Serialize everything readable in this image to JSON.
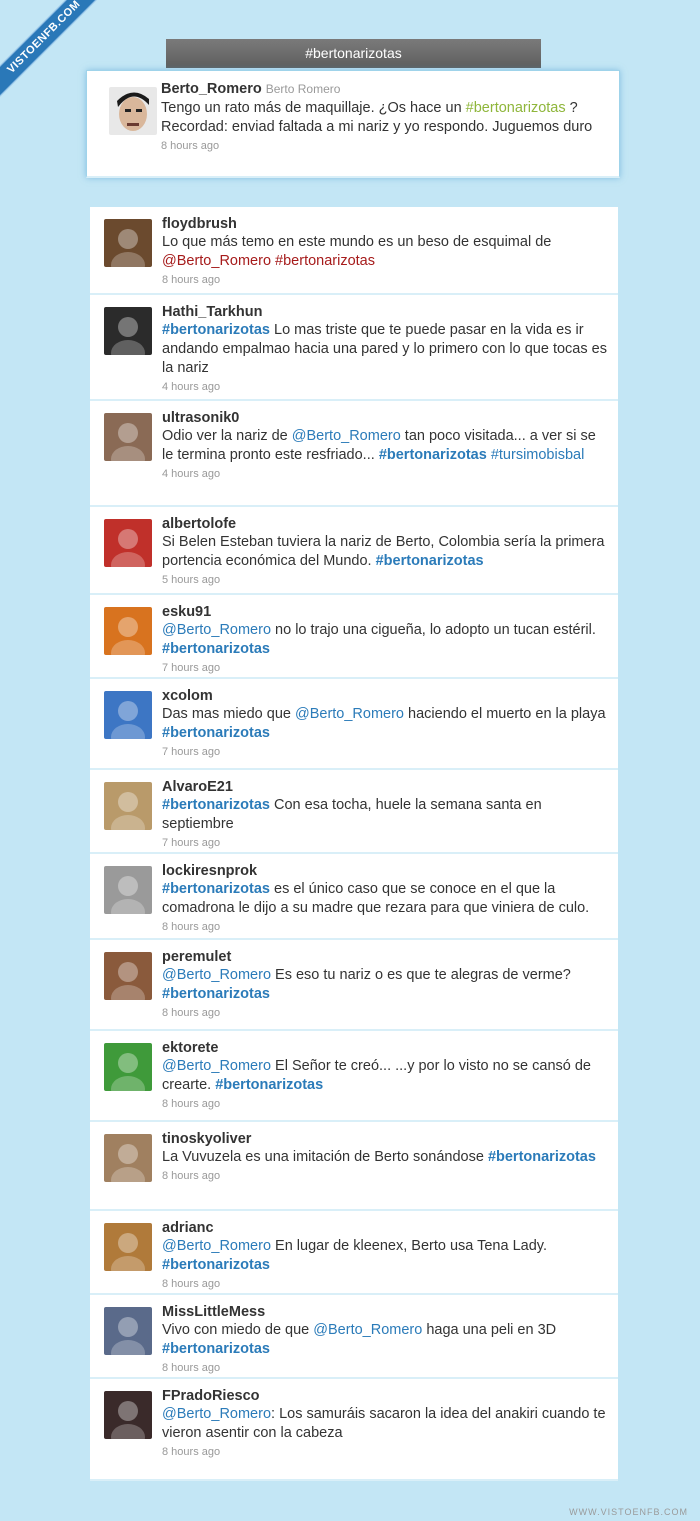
{
  "watermark": "VISTOENFB.COM",
  "footer": "WWW.VISTOENFB.COM",
  "title": "#bertonarizotas",
  "featured": {
    "username": "Berto_Romero",
    "realname": "Berto Romero",
    "text_before": "Tengo un rato más de maquillaje. ¿Os hace un ",
    "hashtag": "#bertonarizotas",
    "text_after": " ? Recordad: enviad faltada a mi nariz y yo respondo. Juguemos duro",
    "time": "8 hours ago",
    "avatar_color": "#d0d0d0"
  },
  "tweets": [
    {
      "username": "floydbrush",
      "segments": [
        {
          "t": "Lo que más temo en este mundo es un beso de esquimal de "
        },
        {
          "t": "@Berto_Romero",
          "k": "mention"
        },
        {
          "t": " "
        },
        {
          "t": "#bertonarizotas",
          "k": "hashtag"
        }
      ],
      "time": "8 hours ago",
      "avatar_color": "#6b4a2e"
    },
    {
      "username": "Hathi_Tarkhun",
      "segments": [
        {
          "t": "#bertonarizotas",
          "k": "hashtag"
        },
        {
          "t": " Lo mas triste que te puede pasar en la vida es ir andando empalmao hacia una pared y lo primero con lo que tocas es la nariz"
        }
      ],
      "time": "4 hours ago",
      "avatar_color": "#2b2b2b"
    },
    {
      "username": "ultrasonik0",
      "segments": [
        {
          "t": "Odio ver la nariz de "
        },
        {
          "t": "@Berto_Romero",
          "k": "mention"
        },
        {
          "t": " tan poco visitada... a ver si se le termina pronto este resfriado... "
        },
        {
          "t": "#bertonarizotas",
          "k": "hashtag"
        },
        {
          "t": " "
        },
        {
          "t": "#tursimobisbal",
          "k": "mention"
        }
      ],
      "time": "4 hours ago",
      "avatar_color": "#8a6a55"
    },
    {
      "username": "albertolofe",
      "segments": [
        {
          "t": "Si Belen Esteban tuviera la nariz de Berto, Colombia sería la primera portencia económica del Mundo. "
        },
        {
          "t": "#bertonarizotas",
          "k": "hashtag"
        }
      ],
      "time": "5 hours ago",
      "avatar_color": "#c0302a"
    },
    {
      "username": "esku91",
      "segments": [
        {
          "t": "@Berto_Romero",
          "k": "mention"
        },
        {
          "t": " no lo trajo una cigueña, lo adopto un tucan estéril. "
        },
        {
          "t": "#bertonarizotas",
          "k": "hashtag"
        }
      ],
      "time": "7 hours ago",
      "avatar_color": "#d8731f"
    },
    {
      "username": "xcolom",
      "segments": [
        {
          "t": "Das mas miedo que "
        },
        {
          "t": "@Berto_Romero",
          "k": "mention"
        },
        {
          "t": " haciendo el muerto en la playa "
        },
        {
          "t": "#bertonarizotas",
          "k": "hashtag"
        }
      ],
      "time": "7 hours ago",
      "avatar_color": "#3d76c4"
    },
    {
      "username": "AlvaroE21",
      "segments": [
        {
          "t": "#bertonarizotas",
          "k": "hashtag"
        },
        {
          "t": " Con esa tocha, huele la semana santa en septiembre"
        }
      ],
      "time": "7 hours ago",
      "avatar_color": "#b99a6a"
    },
    {
      "username": "lockiresnprok",
      "segments": [
        {
          "t": "#bertonarizotas",
          "k": "hashtag"
        },
        {
          "t": " es el único caso que se conoce en el que la comadrona le dijo a su madre que rezara para que viniera de culo."
        }
      ],
      "time": "8 hours ago",
      "avatar_color": "#9a9a9a"
    },
    {
      "username": "peremulet",
      "segments": [
        {
          "t": "@Berto_Romero",
          "k": "mention"
        },
        {
          "t": " Es eso tu nariz o es que te alegras de verme? "
        },
        {
          "t": "#bertonarizotas",
          "k": "hashtag"
        }
      ],
      "time": "8 hours ago",
      "avatar_color": "#8a5a3c"
    },
    {
      "username": "ektorete",
      "segments": [
        {
          "t": "@Berto_Romero",
          "k": "mention"
        },
        {
          "t": " El Señor te creó... ...y por lo visto no se cansó de crearte. "
        },
        {
          "t": "#bertonarizotas",
          "k": "hashtag"
        }
      ],
      "time": "8 hours ago",
      "avatar_color": "#3f9a3a"
    },
    {
      "username": "tinoskyoliver",
      "segments": [
        {
          "t": "La Vuvuzela es una imitación de Berto sonándose "
        },
        {
          "t": "#bertonarizotas",
          "k": "hashtag"
        }
      ],
      "time": "8 hours ago",
      "avatar_color": "#a08060"
    },
    {
      "username": "adrianc",
      "segments": [
        {
          "t": "@Berto_Romero",
          "k": "mention"
        },
        {
          "t": " En lugar de kleenex, Berto usa Tena Lady. "
        },
        {
          "t": "#bertonarizotas",
          "k": "hashtag"
        }
      ],
      "time": "8 hours ago",
      "avatar_color": "#b07a3a"
    },
    {
      "username": "MissLittleMess",
      "segments": [
        {
          "t": "Vivo con miedo de que "
        },
        {
          "t": "@Berto_Romero",
          "k": "mention"
        },
        {
          "t": " haga una peli en 3D "
        },
        {
          "t": "#bertonarizotas",
          "k": "hashtag"
        }
      ],
      "time": "8 hours ago",
      "avatar_color": "#5a6a8a"
    },
    {
      "username": "FPradoRiesco",
      "segments": [
        {
          "t": "@Berto_Romero",
          "k": "mention"
        },
        {
          "t": ": Los samuráis sacaron la idea del anakiri cuando te vieron asentir con la cabeza"
        }
      ],
      "time": "8 hours ago",
      "avatar_color": "#3a2a2a"
    }
  ]
}
